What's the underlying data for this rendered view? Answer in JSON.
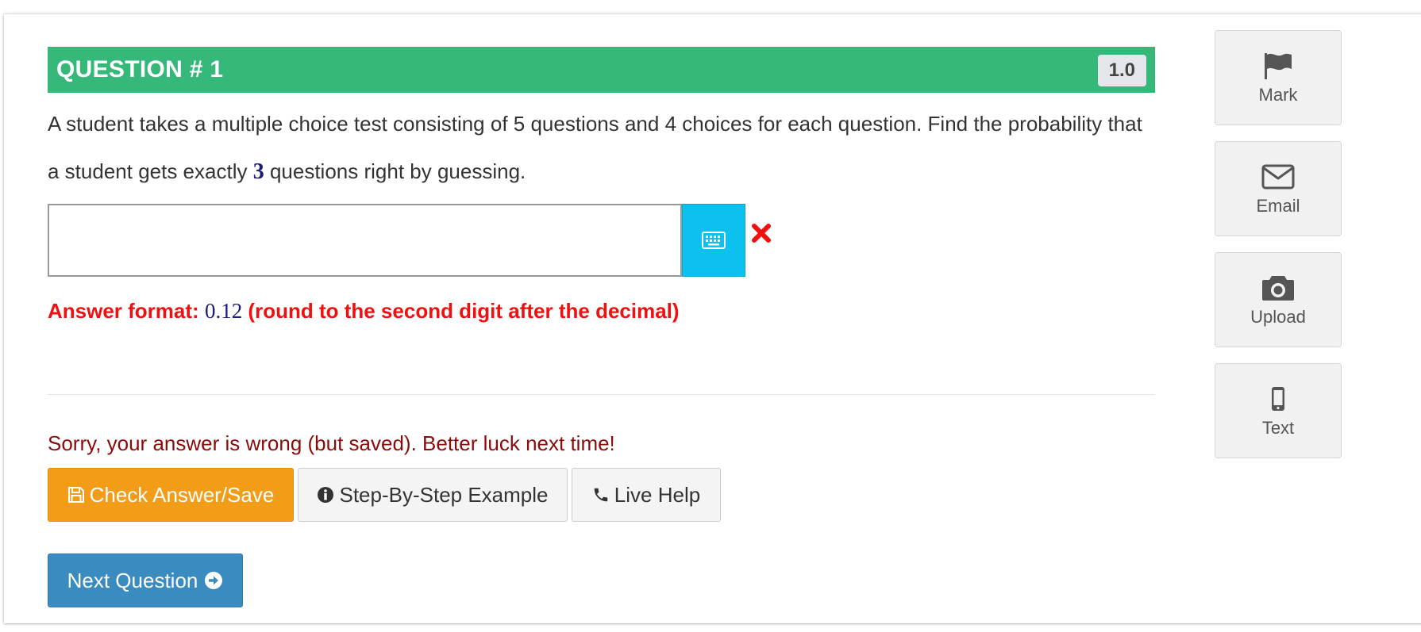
{
  "question": {
    "title": "QUESTION # 1",
    "points": "1.0",
    "text_before": "A student takes a multiple choice test consisting of 5 questions and 4 choices for each question. Find the probability that a student gets exactly ",
    "highlight_number": "3",
    "text_after": " questions right by guessing."
  },
  "answer": {
    "value": "",
    "keyboard_icon": "keyboard-icon",
    "status_icon": "wrong-x-icon",
    "status_color": "#ee1111"
  },
  "format_hint": {
    "label": "Answer format:",
    "example": "0.12",
    "note": "(round to the second digit after the decimal)"
  },
  "feedback": {
    "message": "Sorry, your answer is wrong (but saved). Better luck next time!"
  },
  "buttons": {
    "check": "Check Answer/Save",
    "step": "Step-By-Step Example",
    "live": "Live Help",
    "next": "Next Question"
  },
  "sidebar": {
    "items": [
      {
        "label": "Mark",
        "icon": "flag-icon"
      },
      {
        "label": "Email",
        "icon": "envelope-icon"
      },
      {
        "label": "Upload",
        "icon": "camera-icon"
      },
      {
        "label": "Text",
        "icon": "mobile-phone-icon"
      }
    ]
  },
  "colors": {
    "header": "#35b87a",
    "check_button": "#f39c18",
    "next_button": "#3a8cc0",
    "keyboard_button": "#0cc1ee",
    "feedback_text": "#8b0a0a"
  }
}
